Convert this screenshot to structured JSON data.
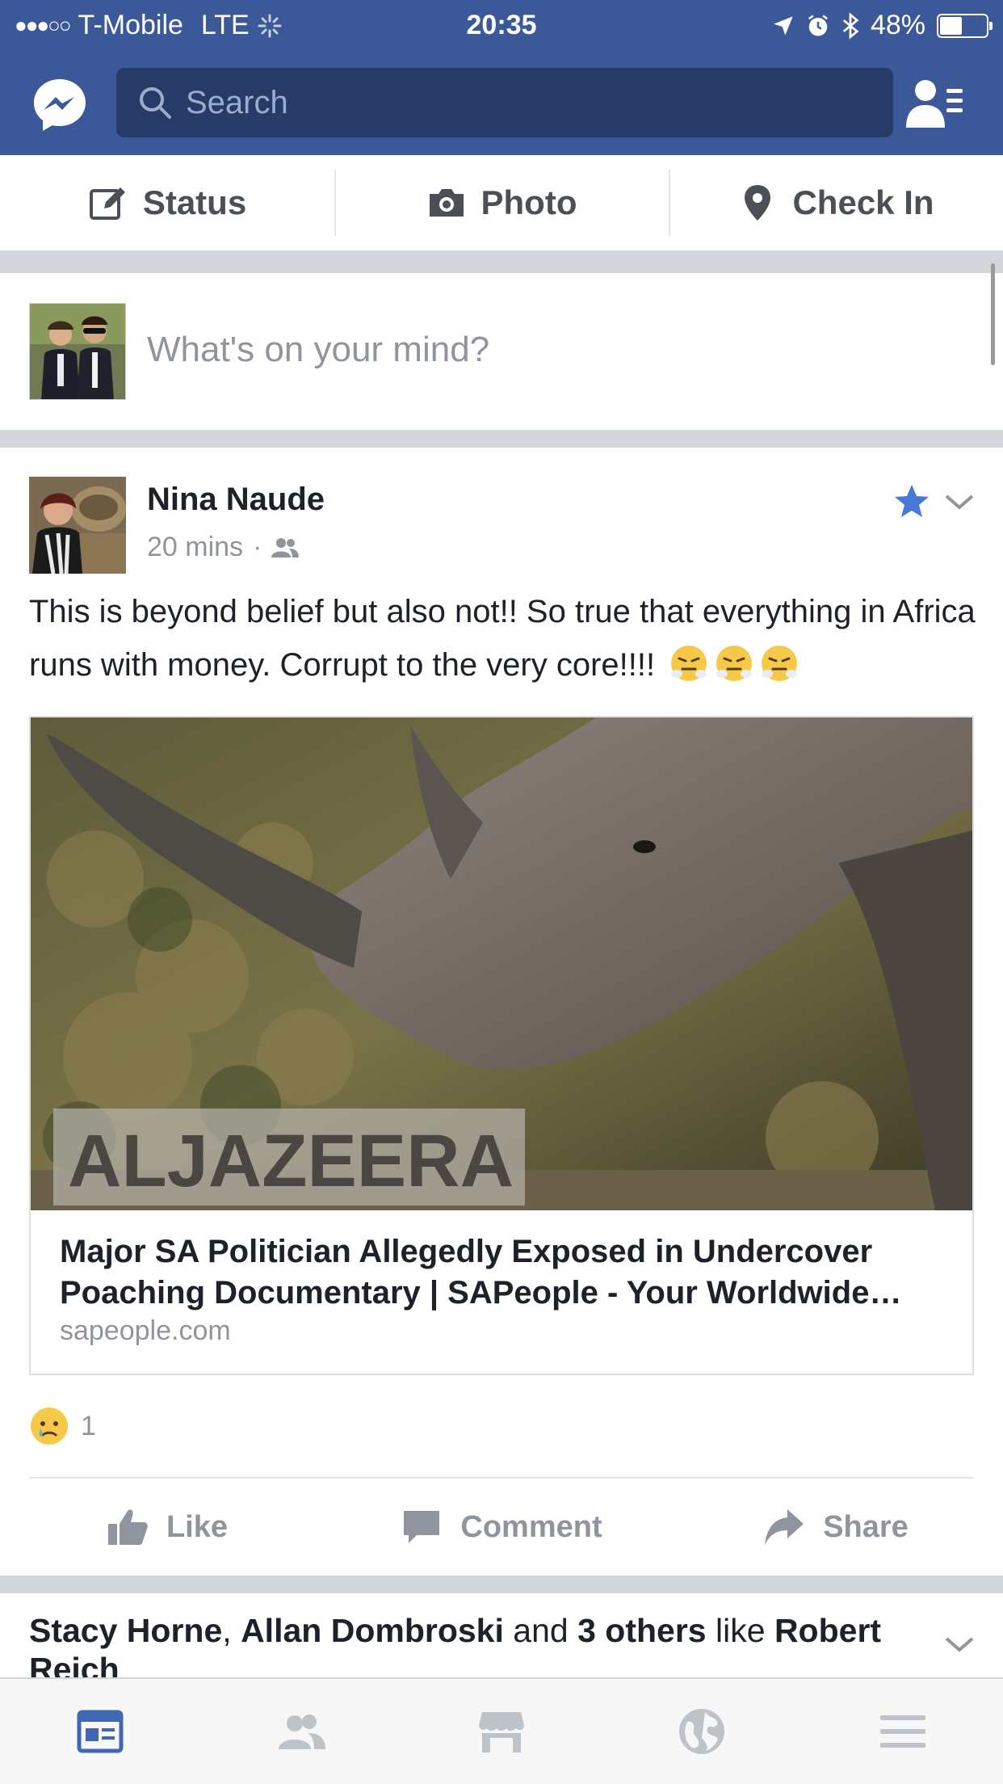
{
  "status_bar": {
    "signal_dots": "●●●○○",
    "carrier": "T-Mobile",
    "network": "LTE",
    "time": "20:35",
    "battery_percent": "48%",
    "battery_level": 0.48
  },
  "header": {
    "search_placeholder": "Search",
    "icons": [
      "messenger-icon",
      "search-icon",
      "friend-requests-icon"
    ],
    "bg_color": "#3b5998"
  },
  "composer": {
    "buttons": [
      {
        "label": "Status",
        "icon": "edit-icon"
      },
      {
        "label": "Photo",
        "icon": "camera-icon"
      },
      {
        "label": "Check In",
        "icon": "location-pin-icon"
      }
    ],
    "prompt": "What's on your mind?"
  },
  "post": {
    "author": "Nina Naude",
    "time": "20 mins",
    "separator": "·",
    "audience_icon": "friends-audience-icon",
    "text": "This is beyond belief but also not!! So true that everything in Africa runs with money. Corrupt to the very core!!!!",
    "emojis": [
      "steam-from-nose-emoji",
      "steam-from-nose-emoji",
      "steam-from-nose-emoji"
    ],
    "link": {
      "image_watermark": "ALJAZEERA",
      "title": "Major SA Politician Allegedly Exposed in Undercover Poaching Documentary | SAPeople - Your Worldwide…",
      "domain": "sapeople.com"
    },
    "reactions": {
      "icon": "sad-reaction-icon",
      "count": "1"
    },
    "actions": [
      {
        "label": "Like",
        "icon": "thumbs-up-icon"
      },
      {
        "label": "Comment",
        "icon": "comment-icon"
      },
      {
        "label": "Share",
        "icon": "share-icon"
      }
    ]
  },
  "next_story": {
    "name1": "Stacy Horne",
    "comma": ",",
    "name2": "Allan Dombroski",
    "and": "and",
    "others": "3 others",
    "like": "like",
    "page": "Robert Reich"
  },
  "tabbar": {
    "tabs": [
      "news-feed-icon",
      "friends-icon",
      "marketplace-icon",
      "notifications-globe-icon",
      "menu-icon"
    ],
    "active_color": "#4267b2",
    "inactive_color": "#bec2c9"
  }
}
